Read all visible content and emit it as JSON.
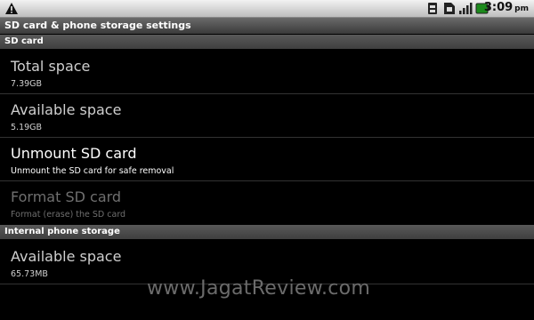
{
  "status_bar": {
    "time": "3:09",
    "ampm": "pm",
    "icons": [
      "warning-icon",
      "sim-icon",
      "sd-icon",
      "signal-icon",
      "battery-icon"
    ]
  },
  "title": "SD card & phone storage settings",
  "sd_card": {
    "header": "SD card",
    "items": [
      {
        "title": "Total space",
        "summary": "7.39GB"
      },
      {
        "title": "Available space",
        "summary": "5.19GB"
      },
      {
        "title": "Unmount SD card",
        "summary": "Unmount the SD card for safe removal"
      },
      {
        "title": "Format SD card",
        "summary": "Format (erase) the SD card"
      }
    ]
  },
  "internal": {
    "header": "Internal phone storage",
    "items": [
      {
        "title": "Available space",
        "summary": "65.73MB"
      }
    ]
  },
  "watermark": "www.JagatReview.com"
}
